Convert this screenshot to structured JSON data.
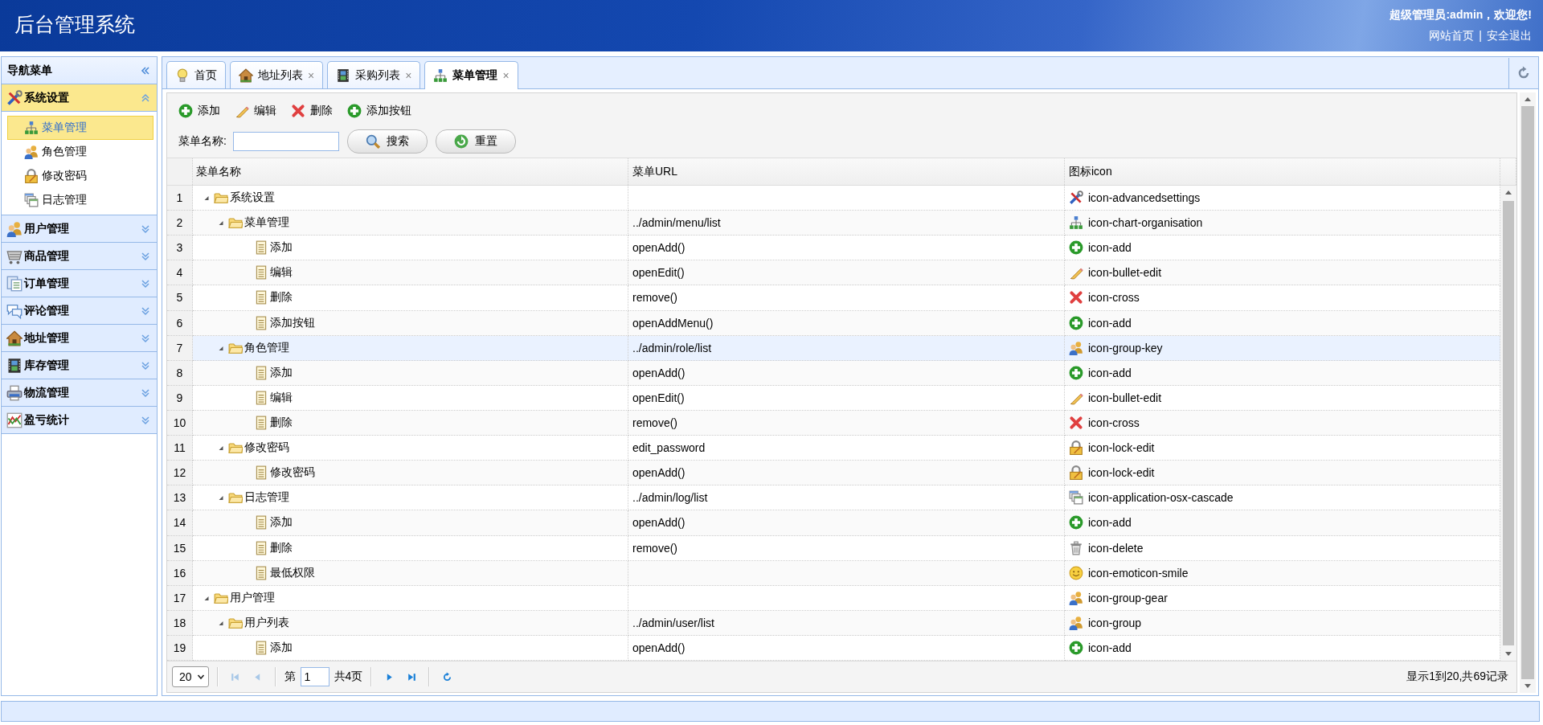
{
  "header": {
    "title": "后台管理系统",
    "welcome": "超级管理员:admin，欢迎您!",
    "links": [
      "网站首页",
      "安全退出"
    ],
    "separator": "|"
  },
  "sidebar": {
    "title": "导航菜单",
    "sections": [
      {
        "label": "系统设置",
        "kind": "settings",
        "expanded": true,
        "items": [
          {
            "label": "菜单管理",
            "kind": "org",
            "selected": true
          },
          {
            "label": "角色管理",
            "kind": "group",
            "selected": false
          },
          {
            "label": "修改密码",
            "kind": "lock",
            "selected": false
          },
          {
            "label": "日志管理",
            "kind": "windows",
            "selected": false
          }
        ]
      },
      {
        "label": "用户管理",
        "kind": "group",
        "expanded": false
      },
      {
        "label": "商品管理",
        "kind": "cart",
        "expanded": false
      },
      {
        "label": "订单管理",
        "kind": "docs",
        "expanded": false
      },
      {
        "label": "评论管理",
        "kind": "chat",
        "expanded": false
      },
      {
        "label": "地址管理",
        "kind": "house",
        "expanded": false
      },
      {
        "label": "库存管理",
        "kind": "film",
        "expanded": false
      },
      {
        "label": "物流管理",
        "kind": "printer",
        "expanded": false
      },
      {
        "label": "盈亏统计",
        "kind": "chart",
        "expanded": false
      }
    ]
  },
  "tabs": [
    {
      "label": "首页",
      "kind": "bulb",
      "closable": false,
      "selected": false
    },
    {
      "label": "地址列表",
      "kind": "house",
      "closable": true,
      "selected": false
    },
    {
      "label": "采购列表",
      "kind": "film",
      "closable": true,
      "selected": false
    },
    {
      "label": "菜单管理",
      "kind": "org",
      "closable": true,
      "selected": true
    }
  ],
  "close_mark": "×",
  "toolbar": [
    {
      "label": "添加",
      "kind": "add"
    },
    {
      "label": "编辑",
      "kind": "edit"
    },
    {
      "label": "删除",
      "kind": "cross"
    },
    {
      "label": "添加按钮",
      "kind": "add"
    }
  ],
  "search": {
    "label": "菜单名称:",
    "buttons": [
      {
        "label": "搜索",
        "kind": "search"
      },
      {
        "label": "重置",
        "kind": "reload"
      }
    ]
  },
  "table": {
    "columns": [
      "菜单名称",
      "菜单URL",
      "图标icon"
    ],
    "rows": [
      {
        "num": "1",
        "name": "系统设置",
        "kind": "folder",
        "expanded": true,
        "selected": false,
        "icon": {
          "kind": "settings",
          "text": "icon-advancedsettings"
        },
        "children": [
          {
            "num": "2",
            "name": "菜单管理",
            "kind": "folder",
            "expanded": true,
            "selected": false,
            "url": "../admin/menu/list",
            "icon": {
              "kind": "org",
              "text": "icon-chart-organisation"
            },
            "children": [
              {
                "num": "3",
                "name": "添加",
                "kind": "leaf",
                "selected": false,
                "url": "openAdd()",
                "icon": {
                  "kind": "add",
                  "text": "icon-add"
                }
              },
              {
                "num": "4",
                "name": "编辑",
                "kind": "leaf",
                "selected": false,
                "url": "openEdit()",
                "icon": {
                  "kind": "edit",
                  "text": "icon-bullet-edit"
                }
              },
              {
                "num": "5",
                "name": "删除",
                "kind": "leaf",
                "selected": false,
                "url": "remove()",
                "icon": {
                  "kind": "cross",
                  "text": "icon-cross"
                }
              },
              {
                "num": "6",
                "name": "添加按钮",
                "kind": "leaf",
                "selected": false,
                "url": "openAddMenu()",
                "icon": {
                  "kind": "add",
                  "text": "icon-add"
                }
              }
            ]
          },
          {
            "num": "7",
            "name": "角色管理",
            "kind": "folder",
            "expanded": true,
            "selected": true,
            "url": "../admin/role/list",
            "icon": {
              "kind": "group",
              "text": "icon-group-key"
            },
            "children": [
              {
                "num": "8",
                "name": "添加",
                "kind": "leaf",
                "selected": false,
                "url": "openAdd()",
                "icon": {
                  "kind": "add",
                  "text": "icon-add"
                }
              },
              {
                "num": "9",
                "name": "编辑",
                "kind": "leaf",
                "selected": false,
                "url": "openEdit()",
                "icon": {
                  "kind": "edit",
                  "text": "icon-bullet-edit"
                }
              },
              {
                "num": "10",
                "name": "删除",
                "kind": "leaf",
                "selected": false,
                "url": "remove()",
                "icon": {
                  "kind": "cross",
                  "text": "icon-cross"
                }
              }
            ]
          },
          {
            "num": "11",
            "name": "修改密码",
            "kind": "folder",
            "expanded": true,
            "selected": false,
            "url": "edit_password",
            "icon": {
              "kind": "lock",
              "text": "icon-lock-edit"
            },
            "children": [
              {
                "num": "12",
                "name": "修改密码",
                "kind": "leaf",
                "selected": false,
                "url": "openAdd()",
                "icon": {
                  "kind": "lock",
                  "text": "icon-lock-edit"
                }
              }
            ]
          },
          {
            "num": "13",
            "name": "日志管理",
            "kind": "folder",
            "expanded": true,
            "selected": false,
            "url": "../admin/log/list",
            "icon": {
              "kind": "windows",
              "text": "icon-application-osx-cascade"
            },
            "children": [
              {
                "num": "14",
                "name": "添加",
                "kind": "leaf",
                "selected": false,
                "url": "openAdd()",
                "icon": {
                  "kind": "add",
                  "text": "icon-add"
                }
              },
              {
                "num": "15",
                "name": "删除",
                "kind": "leaf",
                "selected": false,
                "url": "remove()",
                "icon": {
                  "kind": "trash",
                  "text": "icon-delete"
                }
              },
              {
                "num": "16",
                "name": "最低权限",
                "kind": "leaf",
                "selected": false,
                "icon": {
                  "kind": "smile",
                  "text": "icon-emoticon-smile"
                }
              }
            ]
          }
        ]
      },
      {
        "num": "17",
        "name": "用户管理",
        "kind": "folder",
        "expanded": true,
        "selected": false,
        "icon": {
          "kind": "group",
          "text": "icon-group-gear"
        },
        "children": [
          {
            "num": "18",
            "name": "用户列表",
            "kind": "folder",
            "expanded": true,
            "selected": false,
            "url": "../admin/user/list",
            "icon": {
              "kind": "group",
              "text": "icon-group"
            },
            "children": [
              {
                "num": "19",
                "name": "添加",
                "kind": "leaf",
                "selected": false,
                "url": "openAdd()",
                "icon": {
                  "kind": "add",
                  "text": "icon-add"
                }
              }
            ]
          }
        ]
      }
    ]
  },
  "pager": {
    "page_size": "20",
    "page_prefix": "第",
    "page": "1",
    "page_total": "共4页",
    "info": "显示1到20,共69记录",
    "buttons": [
      {
        "kind": "first",
        "disabled": true
      },
      {
        "kind": "prev",
        "disabled": true
      },
      {
        "kind": "next",
        "disabled": false
      },
      {
        "kind": "last",
        "disabled": false
      }
    ]
  }
}
